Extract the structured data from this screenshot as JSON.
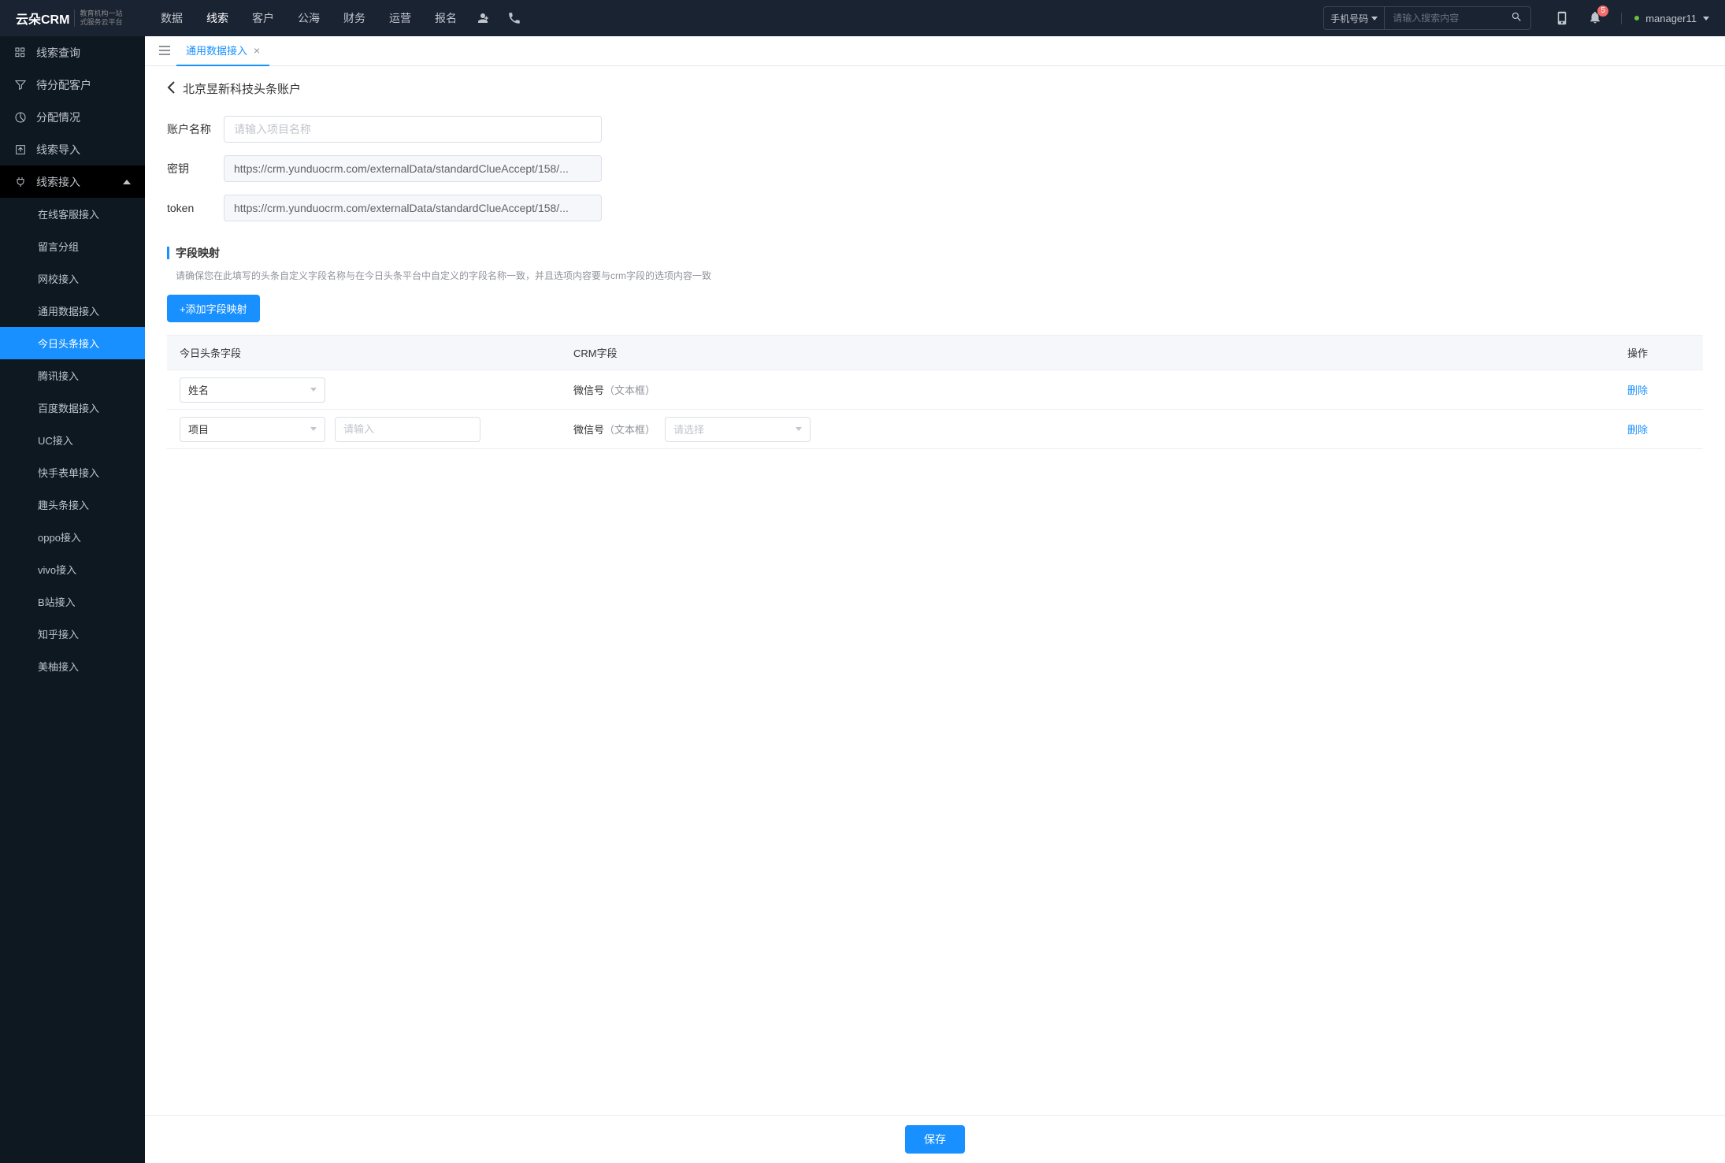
{
  "header": {
    "logo": "云朵CRM",
    "logo_sub": "教育机构一站\n式服务云平台",
    "nav": [
      "数据",
      "线索",
      "客户",
      "公海",
      "财务",
      "运营",
      "报名"
    ],
    "active_nav": "线索",
    "search_type": "手机号码",
    "search_placeholder": "请输入搜索内容",
    "notif_count": "5",
    "username": "manager11"
  },
  "sidebar": {
    "items": [
      {
        "label": "线索查询",
        "icon": "grid"
      },
      {
        "label": "待分配客户",
        "icon": "filter"
      },
      {
        "label": "分配情况",
        "icon": "pie"
      },
      {
        "label": "线索导入",
        "icon": "export"
      },
      {
        "label": "线索接入",
        "icon": "plug",
        "expanded": true,
        "children": [
          {
            "label": "在线客服接入"
          },
          {
            "label": "留言分组"
          },
          {
            "label": "网校接入"
          },
          {
            "label": "通用数据接入"
          },
          {
            "label": "今日头条接入",
            "active": true
          },
          {
            "label": "腾讯接入"
          },
          {
            "label": "百度数据接入"
          },
          {
            "label": "UC接入"
          },
          {
            "label": "快手表单接入"
          },
          {
            "label": "趣头条接入"
          },
          {
            "label": "oppo接入"
          },
          {
            "label": "vivo接入"
          },
          {
            "label": "B站接入"
          },
          {
            "label": "知乎接入"
          },
          {
            "label": "美柚接入"
          }
        ]
      }
    ]
  },
  "tabs": [
    {
      "label": "通用数据接入",
      "active": true
    }
  ],
  "page": {
    "title": "北京昱新科技头条账户",
    "form": {
      "account_label": "账户名称",
      "account_placeholder": "请输入项目名称",
      "secret_label": "密钥",
      "secret_value": "https://crm.yunduocrm.com/externalData/standardClueAccept/158/...",
      "token_label": "token",
      "token_value": "https://crm.yunduocrm.com/externalData/standardClueAccept/158/..."
    },
    "mapping": {
      "title": "字段映射",
      "hint": "请确保您在此填写的头条自定义字段名称与在今日头条平台中自定义的字段名称一致，并且选项内容要与crm字段的选项内容一致",
      "add_btn": "+添加字段映射",
      "columns": [
        "今日头条字段",
        "CRM字段",
        "操作"
      ],
      "rows": [
        {
          "toutiao_field": "姓名",
          "crm_field": "微信号",
          "crm_type": "（文本框）",
          "delete": "删除"
        },
        {
          "toutiao_field": "项目",
          "extra_input_placeholder": "请输入",
          "crm_field": "微信号",
          "crm_type": "（文本框）",
          "crm_select_placeholder": "请选择",
          "delete": "删除"
        }
      ]
    },
    "save_btn": "保存"
  }
}
